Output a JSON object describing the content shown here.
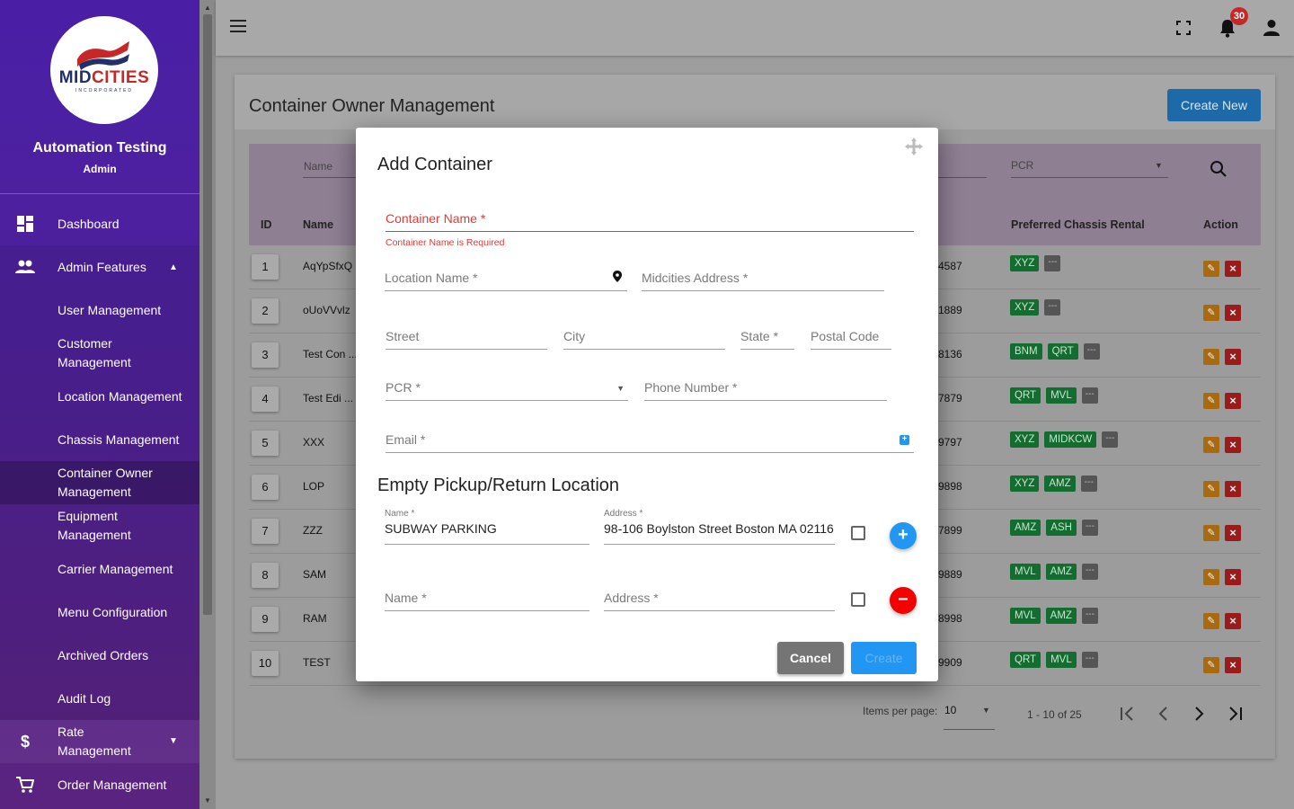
{
  "sidebar": {
    "logo": {
      "mid": "MID",
      "cities": "CITIES",
      "sub": "INCORPORATED"
    },
    "user_name": "Automation Testing",
    "user_role": "Admin",
    "items": [
      {
        "label": "Dashboard",
        "icon": "dashboard-icon"
      },
      {
        "label": "Admin Features",
        "icon": "people-icon"
      },
      {
        "label": "User Management"
      },
      {
        "label": "Customer Management"
      },
      {
        "label": "Location Management"
      },
      {
        "label": "Chassis Management"
      },
      {
        "label": "Container Owner Management"
      },
      {
        "label": "Equipment Management"
      },
      {
        "label": "Carrier Management"
      },
      {
        "label": "Menu Configuration"
      },
      {
        "label": "Archived Orders"
      },
      {
        "label": "Audit Log"
      },
      {
        "label": "Rate Management",
        "icon": "dollar-icon"
      },
      {
        "label": "Order Management",
        "icon": "cart-icon"
      }
    ],
    "active_item": "Container Owner Management"
  },
  "topbar": {
    "notification_count": "30"
  },
  "page": {
    "title": "Container Owner Management",
    "create_new_label": "Create New",
    "filters": {
      "name_placeholder": "Name",
      "pcr_placeholder": "PCR"
    },
    "columns": {
      "id": "ID",
      "name": "Name",
      "preferred_chassis_rental": "Preferred Chassis Rental",
      "action": "Action"
    },
    "rows": [
      {
        "id": "1",
        "name": "AqYpSfxQ",
        "num": "4587",
        "chips": [
          "XYZ"
        ]
      },
      {
        "id": "2",
        "name": "oUoVVvlz",
        "num": "1889",
        "chips": [
          "XYZ"
        ]
      },
      {
        "id": "3",
        "name": "Test Con ...",
        "num": "8136",
        "chips": [
          "BNM",
          "QRT"
        ]
      },
      {
        "id": "4",
        "name": "Test Edi ...",
        "num": "7879",
        "chips": [
          "QRT",
          "MVL"
        ]
      },
      {
        "id": "5",
        "name": "XXX",
        "num": "9797",
        "chips": [
          "XYZ",
          "MIDKCW"
        ]
      },
      {
        "id": "6",
        "name": "LOP",
        "num": "9898",
        "chips": [
          "XYZ",
          "AMZ"
        ]
      },
      {
        "id": "7",
        "name": "ZZZ",
        "num": "7899",
        "chips": [
          "AMZ",
          "ASH"
        ]
      },
      {
        "id": "8",
        "name": "SAM",
        "num": "9889",
        "chips": [
          "MVL",
          "AMZ"
        ]
      },
      {
        "id": "9",
        "name": "RAM",
        "num": "8998",
        "chips": [
          "MVL",
          "AMZ"
        ]
      },
      {
        "id": "10",
        "name": "TEST",
        "num": "9909",
        "chips": [
          "QRT",
          "MVL"
        ]
      }
    ],
    "more_chip": "---",
    "pagination": {
      "items_per_page_label": "Items per page:",
      "items_per_page": "10",
      "range": "1 - 10 of 25"
    }
  },
  "modal": {
    "title": "Add Container",
    "container_name_label": "Container Name *",
    "container_name_error": "Container Name is Required",
    "location_name_label": "Location Name *",
    "midcities_address_label": "Midcities Address *",
    "street_label": "Street",
    "city_label": "City",
    "state_label": "State *",
    "postal_code_label": "Postal Code",
    "pcr_label": "PCR *",
    "phone_label": "Phone Number *",
    "email_label": "Email *",
    "section_title": "Empty Pickup/Return Location",
    "locations": [
      {
        "name_label": "Name *",
        "name_value": "SUBWAY PARKING",
        "address_label": "Address *",
        "address_value": "98-106 Boylston Street Boston MA 02116"
      },
      {
        "name_label": "Name *",
        "name_value": "",
        "address_label": "Address *",
        "address_value": ""
      }
    ],
    "cancel_label": "Cancel",
    "create_label": "Create"
  },
  "colors": {
    "sidebar": "#4a1fa6",
    "primary": "#2196f3",
    "error": "#e53935",
    "chip": "#136c30",
    "danger": "#f40000"
  }
}
